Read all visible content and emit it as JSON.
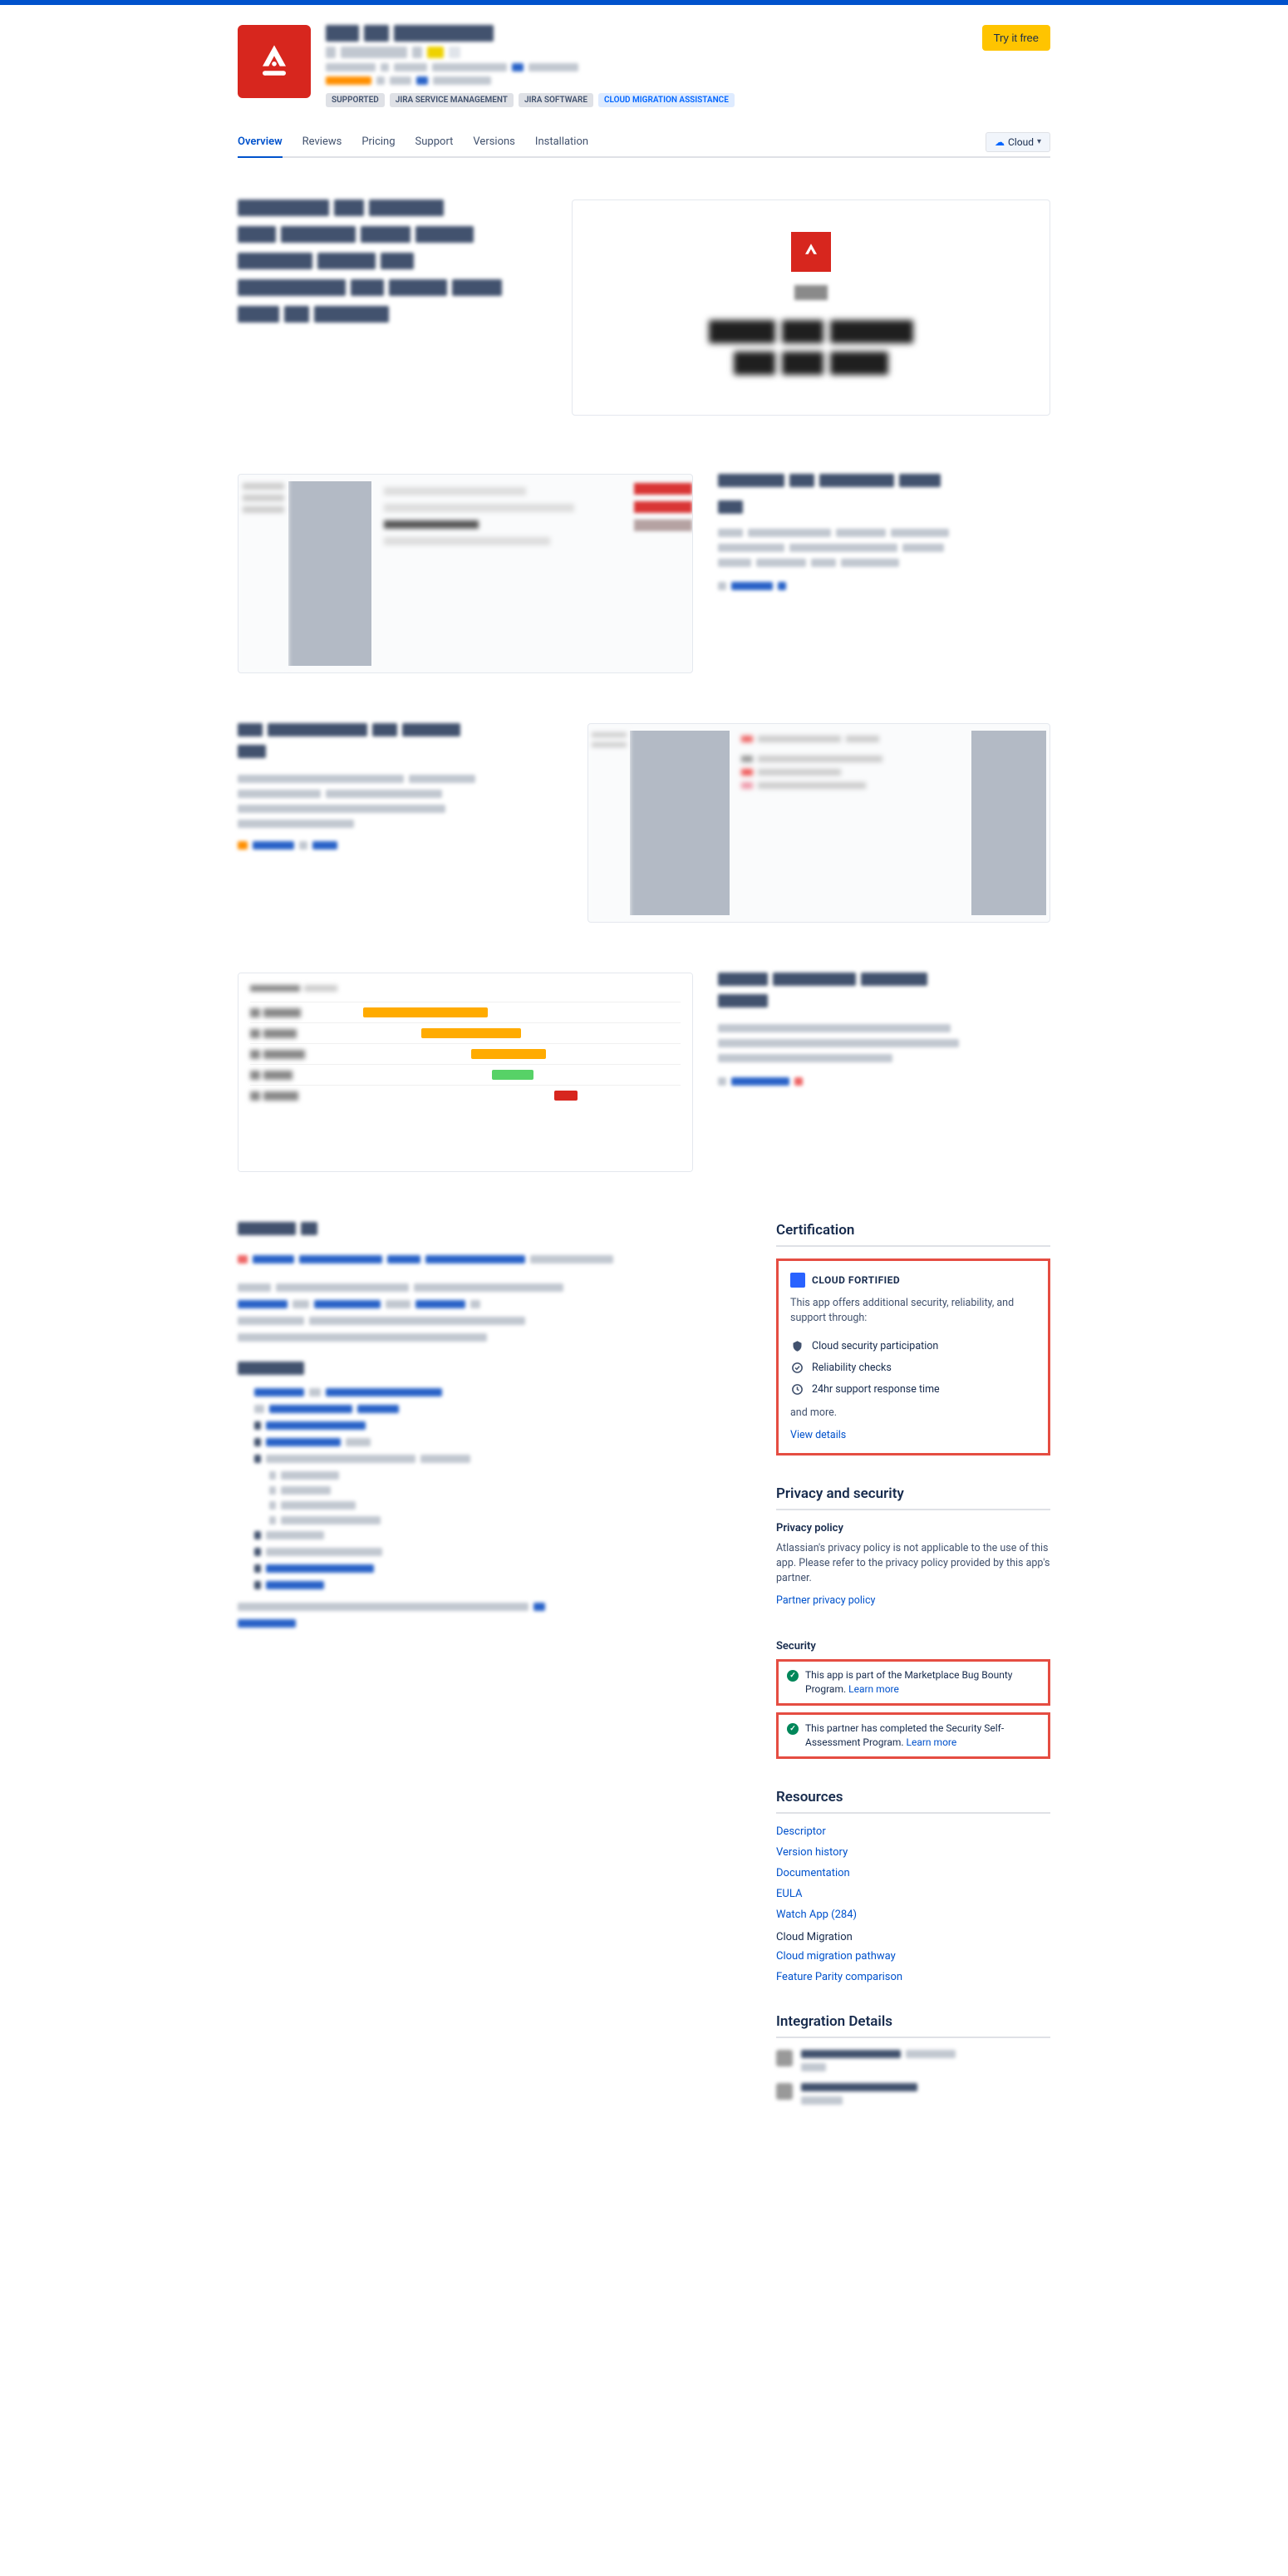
{
  "header": {
    "try_button": "Try it free",
    "tags": {
      "supported": "SUPPORTED",
      "jsm": "JIRA SERVICE MANAGEMENT",
      "jsw": "JIRA SOFTWARE",
      "migration": "CLOUD MIGRATION ASSISTANCE"
    }
  },
  "tabs": {
    "overview": "Overview",
    "reviews": "Reviews",
    "pricing": "Pricing",
    "support": "Support",
    "versions": "Versions",
    "installation": "Installation"
  },
  "dropdown": {
    "label": "Cloud"
  },
  "sidebar": {
    "certification": {
      "title": "Certification",
      "cloud_fortified": "CLOUD FORTIFIED",
      "desc": "This app offers additional security, reliability, and support through:",
      "items": {
        "security": "Cloud security participation",
        "reliability": "Reliability checks",
        "support": "24hr support response time"
      },
      "and_more": "and more.",
      "view_details": "View details"
    },
    "privacy": {
      "title": "Privacy and security",
      "policy_heading": "Privacy policy",
      "policy_text": "Atlassian's privacy policy is not applicable to the use of this app. Please refer to the privacy policy provided by this app's partner.",
      "partner_link": "Partner privacy policy",
      "security_heading": "Security",
      "bug_bounty": "This app is part of the Marketplace Bug Bounty Program.",
      "self_assessment": "This partner has completed the Security Self-Assessment Program.",
      "learn_more": "Learn more"
    },
    "resources": {
      "title": "Resources",
      "links": {
        "descriptor": "Descriptor",
        "version_history": "Version history",
        "documentation": "Documentation",
        "eula": "EULA",
        "watch": "Watch App (284)"
      },
      "cloud_migration_label": "Cloud Migration",
      "cloud_migration_pathway": "Cloud migration pathway",
      "feature_parity": "Feature Parity comparison"
    },
    "integration": {
      "title": "Integration Details"
    }
  }
}
